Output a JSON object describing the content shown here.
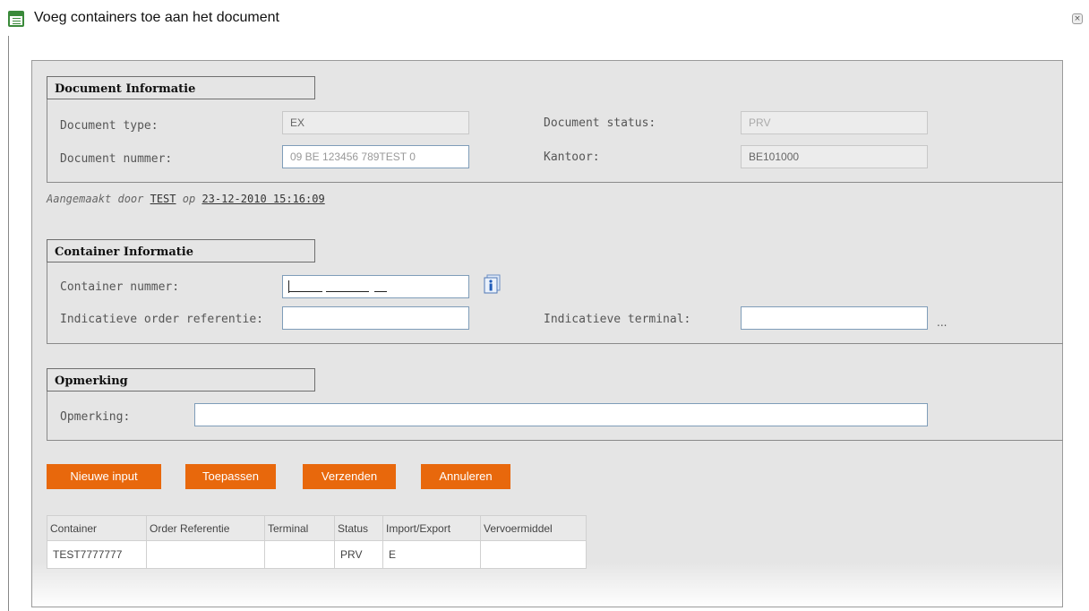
{
  "window": {
    "title": "Voeg containers toe aan het document",
    "close_symbol": "×",
    "icon": "form-document-icon"
  },
  "document_info": {
    "heading": "Document Informatie",
    "type_label": "Document type:",
    "type_value": "EX",
    "status_label": "Document status:",
    "status_value": "PRV",
    "number_label": "Document nummer:",
    "number_value": "09 BE 123456 789TEST 0",
    "office_label": "Kantoor:",
    "office_value": "BE101000"
  },
  "created": {
    "prefix": "Aangemaakt door",
    "user": "TEST",
    "op": "op",
    "timestamp": "23-12-2010 15:16:09"
  },
  "container_info": {
    "heading": "Container Informatie",
    "number_label": "Container nummer:",
    "number_value": "",
    "info_icon": "info-icon",
    "order_ref_label": "Indicatieve order referentie:",
    "order_ref_value": "",
    "terminal_label": "Indicatieve terminal:",
    "terminal_value": "",
    "terminal_lookup": "..."
  },
  "remark": {
    "heading": "Opmerking",
    "label": "Opmerking:",
    "value": ""
  },
  "buttons": {
    "new_input": "Nieuwe input",
    "apply": "Toepassen",
    "send": "Verzenden",
    "cancel": "Annuleren"
  },
  "colors": {
    "button_bg": "#e8680c",
    "panel_bg": "#e5e5e5",
    "title_icon": "#3a8a3a"
  },
  "table": {
    "headers": [
      "Container",
      "Order Referentie",
      "Terminal",
      "Status",
      "Import/Export",
      "Vervoermiddel"
    ],
    "rows": [
      [
        "TEST7777777",
        "",
        "",
        "PRV",
        "E",
        ""
      ]
    ]
  }
}
